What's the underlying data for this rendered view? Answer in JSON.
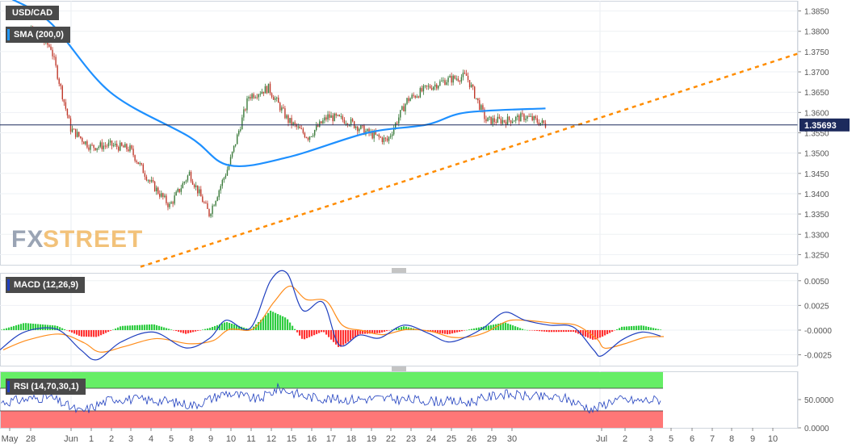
{
  "symbol": "USD/CAD",
  "indicators": {
    "sma_label": "SMA (200,0)",
    "macd_label": "MACD (12,26,9)",
    "rsi_label": "RSI (14,70,30,1)"
  },
  "watermark": {
    "fx": "FX",
    "street": "STREET"
  },
  "colors": {
    "price_up": "#3a7a3a",
    "price_down": "#c0392b",
    "sma": "#1e90ff",
    "trend": "#ff8c00",
    "macd_line": "#1f3fbf",
    "signal_line": "#ff8c1a",
    "hist_pos": "#2ecc40",
    "hist_neg": "#ff3333",
    "rsi_line": "#1f3fbf",
    "rsi_over": "#66ee66",
    "rsi_under": "#ff7777",
    "last_price": "#1c2a5c"
  },
  "chart_data": [
    {
      "type": "candlestick",
      "title": "USD/CAD",
      "ylim": [
        1.3225,
        1.3875
      ],
      "y_ticks": [
        "1.3250",
        "1.3300",
        "1.3350",
        "1.3400",
        "1.3450",
        "1.3500",
        "1.3550",
        "1.3600",
        "1.3650",
        "1.3700",
        "1.3750",
        "1.3800",
        "1.3850"
      ],
      "last_price": "1.35693",
      "x_tick_labels": [
        "May",
        "28",
        "Jun",
        "1",
        "2",
        "3",
        "4",
        "5",
        "8",
        "9",
        "10",
        "11",
        "12",
        "15",
        "16",
        "17",
        "18",
        "19",
        "22",
        "23",
        "24",
        "25",
        "26",
        "29",
        "30",
        "Jul",
        "2",
        "3",
        "6",
        "7",
        "8",
        "9",
        "10"
      ],
      "x_axis_extra": [
        "5"
      ],
      "series_close_approx": {
        "x": [
          "May 27",
          "May 28",
          "May 29",
          "Jun 1",
          "Jun 2",
          "Jun 3",
          "Jun 4",
          "Jun 5",
          "Jun 8",
          "Jun 9",
          "Jun 10",
          "Jun 11",
          "Jun 12",
          "Jun 15",
          "Jun 16",
          "Jun 17",
          "Jun 18",
          "Jun 19",
          "Jun 22",
          "Jun 23",
          "Jun 24",
          "Jun 25",
          "Jun 26",
          "Jun 29",
          "Jun 30",
          "Jul 1",
          "Jul 2",
          "Jul 3"
        ],
        "y": [
          1.379,
          1.38,
          1.376,
          1.356,
          1.3515,
          1.352,
          1.351,
          1.343,
          1.337,
          1.345,
          1.335,
          1.347,
          1.364,
          1.366,
          1.358,
          1.354,
          1.359,
          1.358,
          1.355,
          1.353,
          1.363,
          1.366,
          1.368,
          1.369,
          1.358,
          1.358,
          1.359,
          1.357
        ]
      },
      "sma_200": {
        "x": [
          "May 27",
          "May 29",
          "Jun 3",
          "Jun 9",
          "Jun 11",
          "Jun 16",
          "Jun 22",
          "Jun 25",
          "Jun 29",
          "Jul 3"
        ],
        "y": [
          1.388,
          1.382,
          1.365,
          1.354,
          1.347,
          1.349,
          1.355,
          1.357,
          1.36,
          1.361
        ]
      },
      "trendline": {
        "from": {
          "x": "May 30",
          "y": 1.322
        },
        "to": {
          "x": "Jul 6",
          "y": 1.3745
        }
      }
    },
    {
      "type": "line",
      "title": "MACD (12,26,9)",
      "ylim": [
        -0.0036,
        0.0058
      ],
      "y_ticks": [
        "0.0050",
        "0.0025",
        "-0.0000",
        "-0.0025"
      ],
      "series": [
        {
          "name": "MACD"
        },
        {
          "name": "Signal"
        },
        {
          "name": "Histogram"
        }
      ]
    },
    {
      "type": "line",
      "title": "RSI (14,70,30,1)",
      "ylim": [
        0,
        100
      ],
      "y_ticks": [
        "50.0000",
        "0.0000"
      ],
      "overbought": 70,
      "oversold": 30
    }
  ]
}
